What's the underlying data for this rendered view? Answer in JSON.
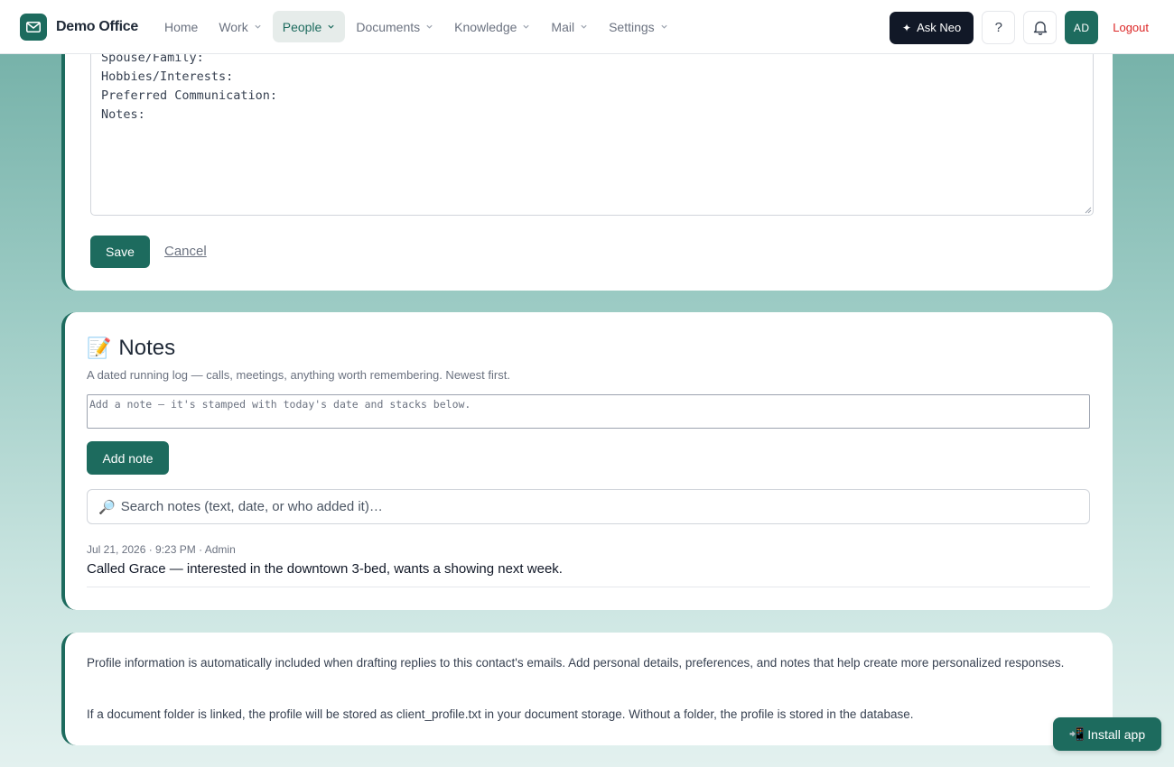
{
  "brand": {
    "name": "Demo Office"
  },
  "nav": {
    "items": [
      {
        "label": "Home",
        "has_chevron": false,
        "active": false
      },
      {
        "label": "Work",
        "has_chevron": true,
        "active": false
      },
      {
        "label": "People",
        "has_chevron": true,
        "active": true
      },
      {
        "label": "Documents",
        "has_chevron": true,
        "active": false
      },
      {
        "label": "Knowledge",
        "has_chevron": true,
        "active": false
      },
      {
        "label": "Mail",
        "has_chevron": true,
        "active": false
      },
      {
        "label": "Settings",
        "has_chevron": true,
        "active": false
      }
    ],
    "ask_neo_label": "Ask Neo",
    "help_label": "?",
    "avatar_initials": "AD",
    "logout_label": "Logout"
  },
  "profile": {
    "text": "Spouse/Family:\nHobbies/Interests:\nPreferred Communication:\nNotes:",
    "save_label": "Save",
    "cancel_label": "Cancel"
  },
  "notes": {
    "title": "Notes",
    "title_icon": "memo-emoji",
    "subtitle": "A dated running log — calls, meetings, anything worth remembering. Newest first.",
    "input_placeholder": "Add a note — it's stamped with today's date and stacks below.",
    "add_label": "Add note",
    "search_placeholder": "Search notes (text, date, or who added it)…",
    "entries": [
      {
        "meta": "Jul 21, 2026 · 9:23 PM · Admin",
        "text": "Called Grace — interested in the downtown 3-bed, wants a showing next week."
      }
    ]
  },
  "info": {
    "p1": "Profile information is automatically included when drafting replies to this contact's emails. Add personal details, preferences, and notes that help create more personalized responses.",
    "p2": "If a document folder is linked, the profile will be stored as client_profile.txt in your document storage. Without a folder, the profile is stored in the database."
  },
  "install_label": "Install app",
  "colors": {
    "accent": "#1d6b5e",
    "danger": "#dc2626",
    "dark": "#111827"
  }
}
